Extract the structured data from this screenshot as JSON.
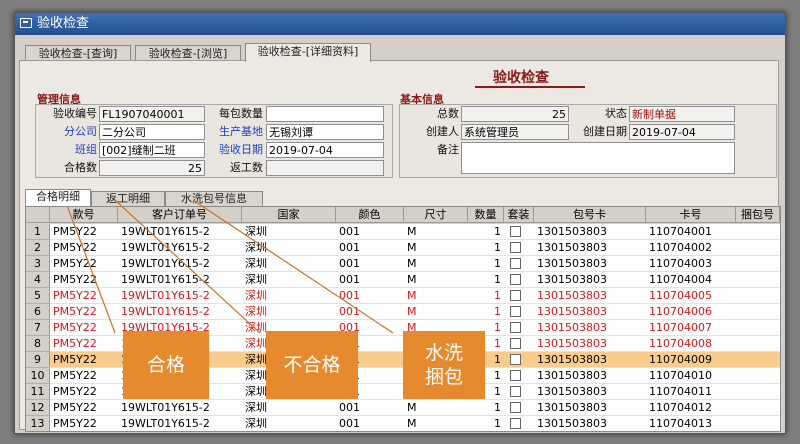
{
  "window": {
    "title": "验收检查"
  },
  "tabs": [
    "验收检查-[查询]",
    "验收检查-[浏览]",
    "验收检查-[详细资料]"
  ],
  "heading": "验收检查",
  "management": {
    "title": "管理信息",
    "receipt_no_label": "验收编号",
    "receipt_no": "FL1907040001",
    "per_pack_label": "每包数量",
    "per_pack": "",
    "branch_label": "分公司",
    "branch": "二分公司",
    "base_label": "生产基地",
    "base": "无锡刘谭",
    "team_label": "班组",
    "team": "[002]缝制二班",
    "date_label": "验收日期",
    "date": "2019-07-04",
    "qualified_label": "合格数",
    "qualified": "25",
    "rework_label": "返工数",
    "rework": ""
  },
  "basic": {
    "title": "基本信息",
    "total_label": "总数",
    "total": "25",
    "status_label": "状态",
    "status": "新制单据",
    "creator_label": "创建人",
    "creator": "系统管理员",
    "created_label": "创建日期",
    "created": "2019-07-04",
    "remark_label": "备注",
    "remark": ""
  },
  "subtabs": [
    "合格明细",
    "返工明细",
    "水洗包号信息"
  ],
  "columns": [
    "款号",
    "客户订单号",
    "国家",
    "颜色",
    "尺寸",
    "数量",
    "套装",
    "包号卡",
    "卡号",
    "捆包号"
  ],
  "rows": [
    {
      "n": "1",
      "style": "PM5Y22",
      "order": "19WLT01Y615-2",
      "country": "深圳",
      "color": "001",
      "size": "M",
      "qty": "1",
      "pack": "1301503803",
      "card": "110704001"
    },
    {
      "n": "2",
      "style": "PM5Y22",
      "order": "19WLT01Y615-2",
      "country": "深圳",
      "color": "001",
      "size": "M",
      "qty": "1",
      "pack": "1301503803",
      "card": "110704002"
    },
    {
      "n": "3",
      "style": "PM5Y22",
      "order": "19WLT01Y615-2",
      "country": "深圳",
      "color": "001",
      "size": "M",
      "qty": "1",
      "pack": "1301503803",
      "card": "110704003"
    },
    {
      "n": "4",
      "style": "PM5Y22",
      "order": "19WLT01Y615-2",
      "country": "深圳",
      "color": "001",
      "size": "M",
      "qty": "1",
      "pack": "1301503803",
      "card": "110704004"
    },
    {
      "n": "5",
      "style": "PM5Y22",
      "order": "19WLT01Y615-2",
      "country": "深圳",
      "color": "001",
      "size": "M",
      "qty": "1",
      "pack": "1301503803",
      "card": "110704005"
    },
    {
      "n": "6",
      "style": "PM5Y22",
      "order": "19WLT01Y615-2",
      "country": "深圳",
      "color": "001",
      "size": "M",
      "qty": "1",
      "pack": "1301503803",
      "card": "110704006"
    },
    {
      "n": "7",
      "style": "PM5Y22",
      "order": "19WLT01Y615-2",
      "country": "深圳",
      "color": "001",
      "size": "M",
      "qty": "1",
      "pack": "1301503803",
      "card": "110704007"
    },
    {
      "n": "8",
      "style": "PM5Y22",
      "order": "19WLT01Y615-2",
      "country": "深圳",
      "color": "001",
      "size": "M",
      "qty": "1",
      "pack": "1301503803",
      "card": "110704008"
    },
    {
      "n": "9",
      "style": "PM5Y22",
      "order": "19WLT01Y615-2",
      "country": "深圳",
      "color": "001",
      "size": "M",
      "qty": "1",
      "pack": "1301503803",
      "card": "110704009"
    },
    {
      "n": "10",
      "style": "PM5Y22",
      "order": "19WLT01Y615-2",
      "country": "深圳",
      "color": "001",
      "size": "M",
      "qty": "1",
      "pack": "1301503803",
      "card": "110704010"
    },
    {
      "n": "11",
      "style": "PM5Y22",
      "order": "19WLT01Y615-2",
      "country": "深圳",
      "color": "001",
      "size": "M",
      "qty": "1",
      "pack": "1301503803",
      "card": "110704011"
    },
    {
      "n": "12",
      "style": "PM5Y22",
      "order": "19WLT01Y615-2",
      "country": "深圳",
      "color": "001",
      "size": "M",
      "qty": "1",
      "pack": "1301503803",
      "card": "110704012"
    },
    {
      "n": "13",
      "style": "PM5Y22",
      "order": "19WLT01Y615-2",
      "country": "深圳",
      "color": "001",
      "size": "M",
      "qty": "1",
      "pack": "1301503803",
      "card": "110704013"
    }
  ],
  "callouts": {
    "qualified": "合格",
    "unqualified": "不合格",
    "wash_line1": "水洗",
    "wash_line2": "捆包"
  },
  "colors": {
    "title_bar": "#2f5f9e",
    "accent_red": "#8a1a1a",
    "row_red": "#d01818",
    "selection": "#f9cc8e",
    "callout": "#e58a2e"
  }
}
